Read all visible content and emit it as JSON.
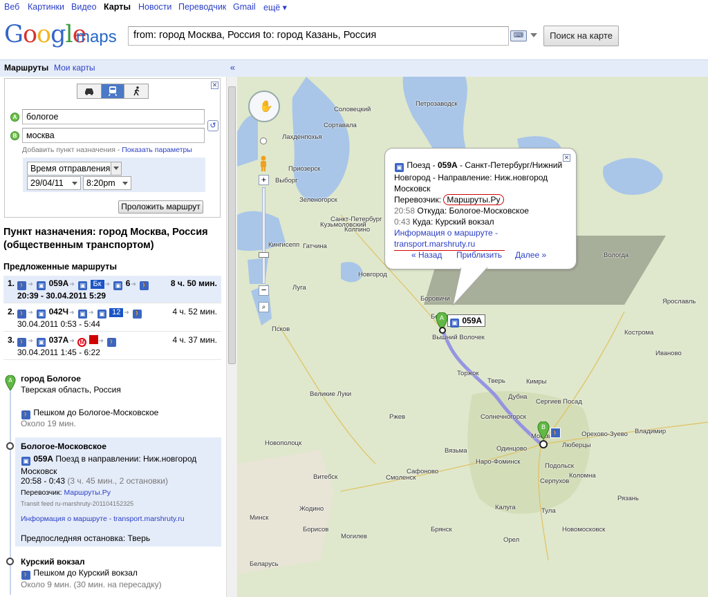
{
  "topnav": [
    "Веб",
    "Картинки",
    "Видео",
    "Карты",
    "Новости",
    "Переводчик",
    "Gmail",
    "ещё ▾"
  ],
  "logo": {
    "google": "Google",
    "maps": "maps"
  },
  "search": {
    "value": "from: город Москва, Россия to: город Казань, Россия",
    "button": "Поиск на карте",
    "keyboard_icon": "keyboard-icon"
  },
  "tabs": {
    "routes": "Маршруты",
    "my_maps": "Мои карты",
    "collapse": "«"
  },
  "form": {
    "from": "бологое",
    "to": "москва",
    "add_dest": "Добавить пункт назначения",
    "separator": " - ",
    "show_options": "Показать параметры",
    "time_mode": "Время отправления",
    "date": "29/04/11",
    "time": "8:20pm",
    "submit": "Проложить маршрут",
    "pin_a": "A",
    "pin_b": "B"
  },
  "destination": "Пункт назначения: город Москва, Россия (общественным транспортом)",
  "suggested_title": "Предложенные маршруты",
  "routes": [
    {
      "num": "1.",
      "train": "059A",
      "bus_label": "Бк",
      "bus2": "6",
      "duration": "8 ч. 50 мин.",
      "times": "20:39 - 30.04.2011 5:29"
    },
    {
      "num": "2.",
      "train": "042Ч",
      "bus_label": "12",
      "duration": "4 ч. 52 мин.",
      "times": "30.04.2011 0:53 - 5:44"
    },
    {
      "num": "3.",
      "train": "037А",
      "metro": "М",
      "duration": "4 ч. 37 мин.",
      "times": "30.04.2011 1:45 - 6:22"
    }
  ],
  "steps": {
    "start_name": "город Бологое",
    "start_region": "Тверская область, Россия",
    "walk1": "Пешком до Бологое-Московское",
    "walk1_time": "Около 19 мин.",
    "station": "Бологое-Московское",
    "train_num": "059А",
    "train_dir": "Поезд в направлении: Ниж.новгород Московск",
    "train_time": "20:58 - 0:43",
    "train_detail": "(3 ч. 45 мин., 2 остановки)",
    "carrier_label": "Перевозчик:",
    "carrier": "Маршруты.Ру",
    "feed": "Transit feed ru-marshruty-201104152325",
    "route_info": "Информация о маршруте - transport.marshruty.ru",
    "penultimate": "Предпоследняя остановка: Тверь",
    "end_station": "Курский вокзал",
    "walk2": "Пешком до Курский вокзал",
    "walk2_time": "Около 9 мин. (30 мин. на пересадку)"
  },
  "popup": {
    "line1_prefix": "Поезд - ",
    "line1_num": "059A",
    "line1_rest": " - Санкт-Петербург/Нижний Новгород - Направление: Ниж.новгород Московск",
    "carrier_label": "Перевозчик: ",
    "carrier": "Маршруты.Ру",
    "dep_time": "20:58",
    "dep": " Откуда: Бологое-Московское",
    "arr_time": "0:43",
    "arr": "  Куда: Курский вокзал",
    "info": "Информация о маршруте - transport.marshruty.ru",
    "back": "« Назад",
    "zoom": "Приблизить",
    "next": "Далее »"
  },
  "map_marker_label": "059A",
  "map_labels": [
    {
      "t": "Петрозаводск"
    },
    {
      "t": "Соловецкий"
    },
    {
      "t": "Сортавала"
    },
    {
      "t": "Лахденпохья"
    },
    {
      "t": "Приозерск"
    },
    {
      "t": "Выборг"
    },
    {
      "t": "Зеленогорск"
    },
    {
      "t": "Санкт-Петербург"
    },
    {
      "t": "Кузьмоловский"
    },
    {
      "t": "Колпино"
    },
    {
      "t": "Кингисепп"
    },
    {
      "t": "Гатчина"
    },
    {
      "t": "Луга"
    },
    {
      "t": "Псков"
    },
    {
      "t": "Новгород"
    },
    {
      "t": "Боровичи"
    },
    {
      "t": "Бологое"
    },
    {
      "t": "Вышний Волочек"
    },
    {
      "t": "Торжок"
    },
    {
      "t": "Тверь"
    },
    {
      "t": "Кимры"
    },
    {
      "t": "Дубна"
    },
    {
      "t": "Сергиев Посад"
    },
    {
      "t": "Солнечногорск"
    },
    {
      "t": "Одинцово"
    },
    {
      "t": "Люберцы"
    },
    {
      "t": "Подольск"
    },
    {
      "t": "Коломна"
    },
    {
      "t": "Серпухов"
    },
    {
      "t": "Наро-Фоминск"
    },
    {
      "t": "Калуга"
    },
    {
      "t": "Тула"
    },
    {
      "t": "Новомосковск"
    },
    {
      "t": "Рязань"
    },
    {
      "t": "Орехово-Зуево"
    },
    {
      "t": "Владимир"
    },
    {
      "t": "Вологда"
    },
    {
      "t": "Кострома"
    },
    {
      "t": "Иваново"
    },
    {
      "t": "Ярославль"
    },
    {
      "t": "Смоленск"
    },
    {
      "t": "Витебск"
    },
    {
      "t": "Минск"
    },
    {
      "t": "Брянск"
    },
    {
      "t": "Великие Луки"
    },
    {
      "t": "Новополоцк"
    },
    {
      "t": "Сафоново"
    },
    {
      "t": "Вязьма"
    },
    {
      "t": "Ржев"
    },
    {
      "t": "Борисов"
    },
    {
      "t": "Беларусь"
    },
    {
      "t": "Жодино"
    },
    {
      "t": "Могилев"
    },
    {
      "t": "Орел"
    },
    {
      "t": "Москва"
    }
  ],
  "colors": {
    "accent": "#2a3fc6",
    "route": "#8a86e6",
    "panel_bg": "#e5ecf9",
    "map_bg": "#dfe8cc",
    "water": "#a9c6e8"
  }
}
